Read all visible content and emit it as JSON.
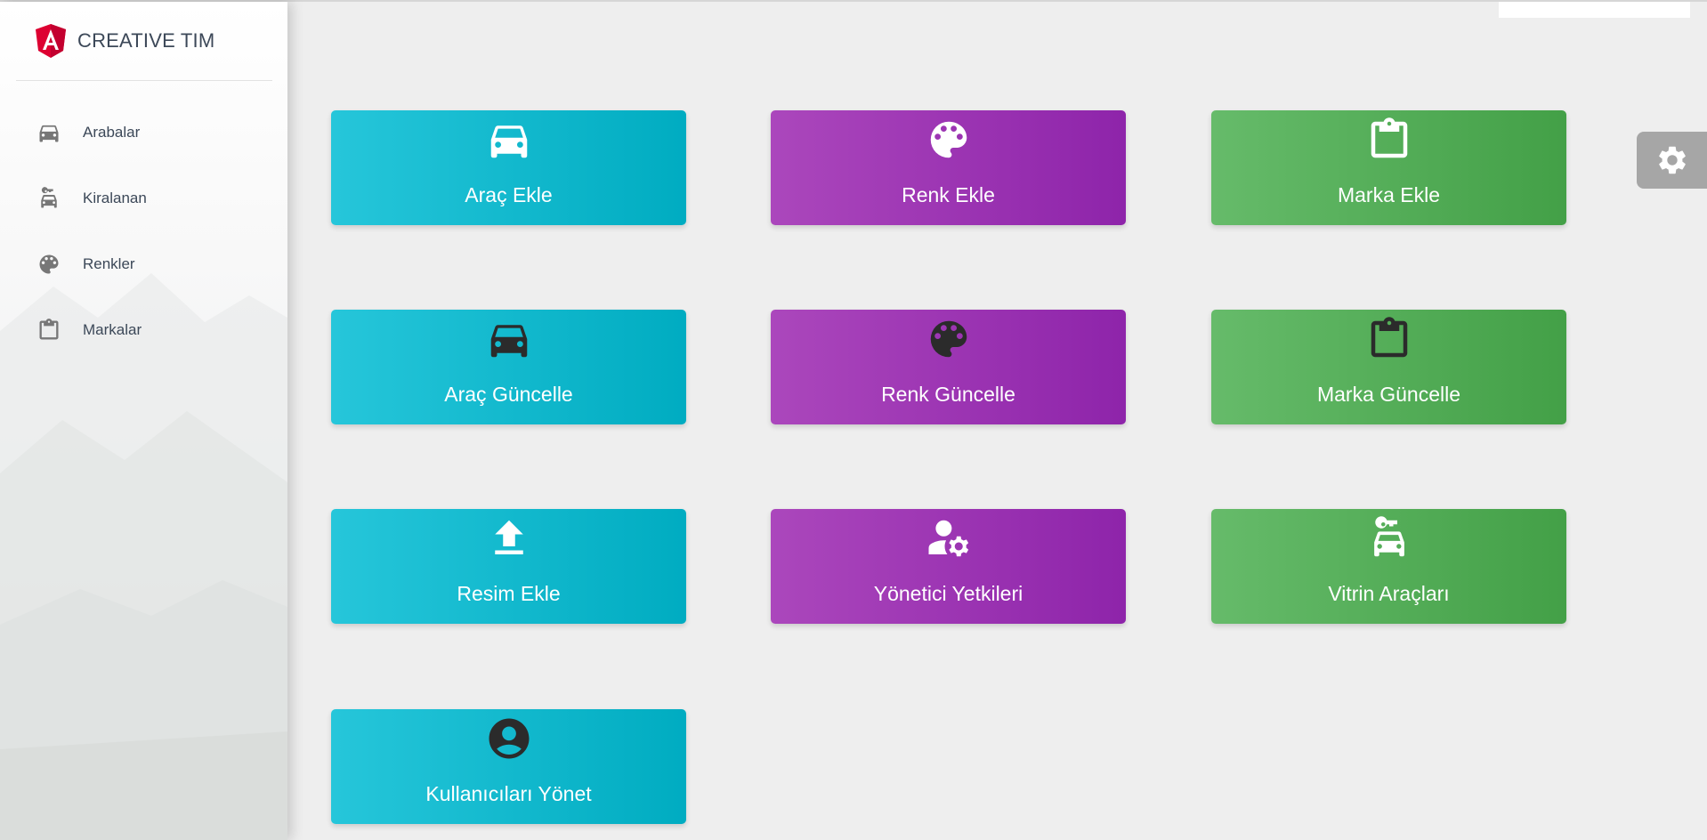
{
  "brand": {
    "name": "CREATIVE TIM",
    "logo_icon": "angular-shield-icon"
  },
  "sidebar": {
    "items": [
      {
        "label": "Arabalar",
        "icon": "car-icon"
      },
      {
        "label": "Kiralanan",
        "icon": "car-rental-icon"
      },
      {
        "label": "Renkler",
        "icon": "palette-icon"
      },
      {
        "label": "Markalar",
        "icon": "clipboard-icon"
      }
    ]
  },
  "cards": [
    {
      "label": "Araç Ekle",
      "icon": "car-icon",
      "color": "#00acc1"
    },
    {
      "label": "Renk Ekle",
      "icon": "palette-icon",
      "color": "#8e24aa"
    },
    {
      "label": "Marka Ekle",
      "icon": "clipboard-icon",
      "color": "#43a047"
    },
    {
      "label": "Araç Güncelle",
      "icon": "car-icon",
      "color": "#00acc1"
    },
    {
      "label": "Renk Güncelle",
      "icon": "palette-icon",
      "color": "#8e24aa"
    },
    {
      "label": "Marka Güncelle",
      "icon": "clipboard-icon",
      "color": "#43a047"
    },
    {
      "label": "Resim Ekle",
      "icon": "upload-icon",
      "color": "#00acc1"
    },
    {
      "label": "Yönetici Yetkileri",
      "icon": "manage-accounts-icon",
      "color": "#8e24aa"
    },
    {
      "label": "Vitrin Araçları",
      "icon": "car-rental-icon",
      "color": "#43a047"
    },
    {
      "label": "Kullanıcıları Yönet",
      "icon": "account-circle-icon",
      "color": "#00acc1"
    }
  ],
  "colors": {
    "cyan": "#00acc1",
    "purple": "#8e24aa",
    "green": "#43a047",
    "dark_icon": "#2b2b2b",
    "sidebar_text": "#3c4858"
  },
  "settings": {
    "icon": "gear-icon"
  }
}
